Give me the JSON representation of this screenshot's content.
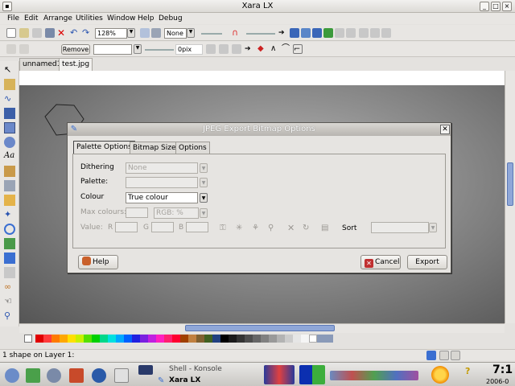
{
  "window": {
    "title": "Xara LX"
  },
  "menu": [
    "File",
    "Edit",
    "Arrange",
    "Utilities",
    "Window",
    "Help",
    "Debug"
  ],
  "toolbar": {
    "zoom": "128%",
    "quality": "None",
    "remove_label": "Remove",
    "size_value": "0pix"
  },
  "doc_tabs": [
    "unnamed1",
    "test.jpg"
  ],
  "dialog": {
    "title": "JPEG Export Bitmap Options",
    "tabs": [
      "Palette Options",
      "Bitmap Size",
      "Options"
    ],
    "dithering_label": "Dithering",
    "dithering_value": "None",
    "palette_label": "Palette:",
    "palette_value": "",
    "colour_label": "Colour",
    "colour_value": "True colour",
    "max_colours_label": "Max colours:",
    "max_colours_value": "",
    "rgb_value": "RGB: %",
    "value_label": "Value:",
    "r_label": "R",
    "g_label": "G",
    "b_label": "B",
    "sort_label": "Sort",
    "help_label": "Help",
    "cancel_label": "Cancel",
    "export_label": "Export"
  },
  "status": {
    "text": "1 shape on Layer 1:"
  },
  "taskbar": {
    "task1": "Shell - Konsole",
    "task2": "Xara LX",
    "clock_time": "7:1",
    "clock_date": "2006-0"
  },
  "colors": {
    "dialog_bg": "#e6e4e1",
    "canvas_dark": "#555555",
    "accent_blue": "#3b6fd1"
  }
}
